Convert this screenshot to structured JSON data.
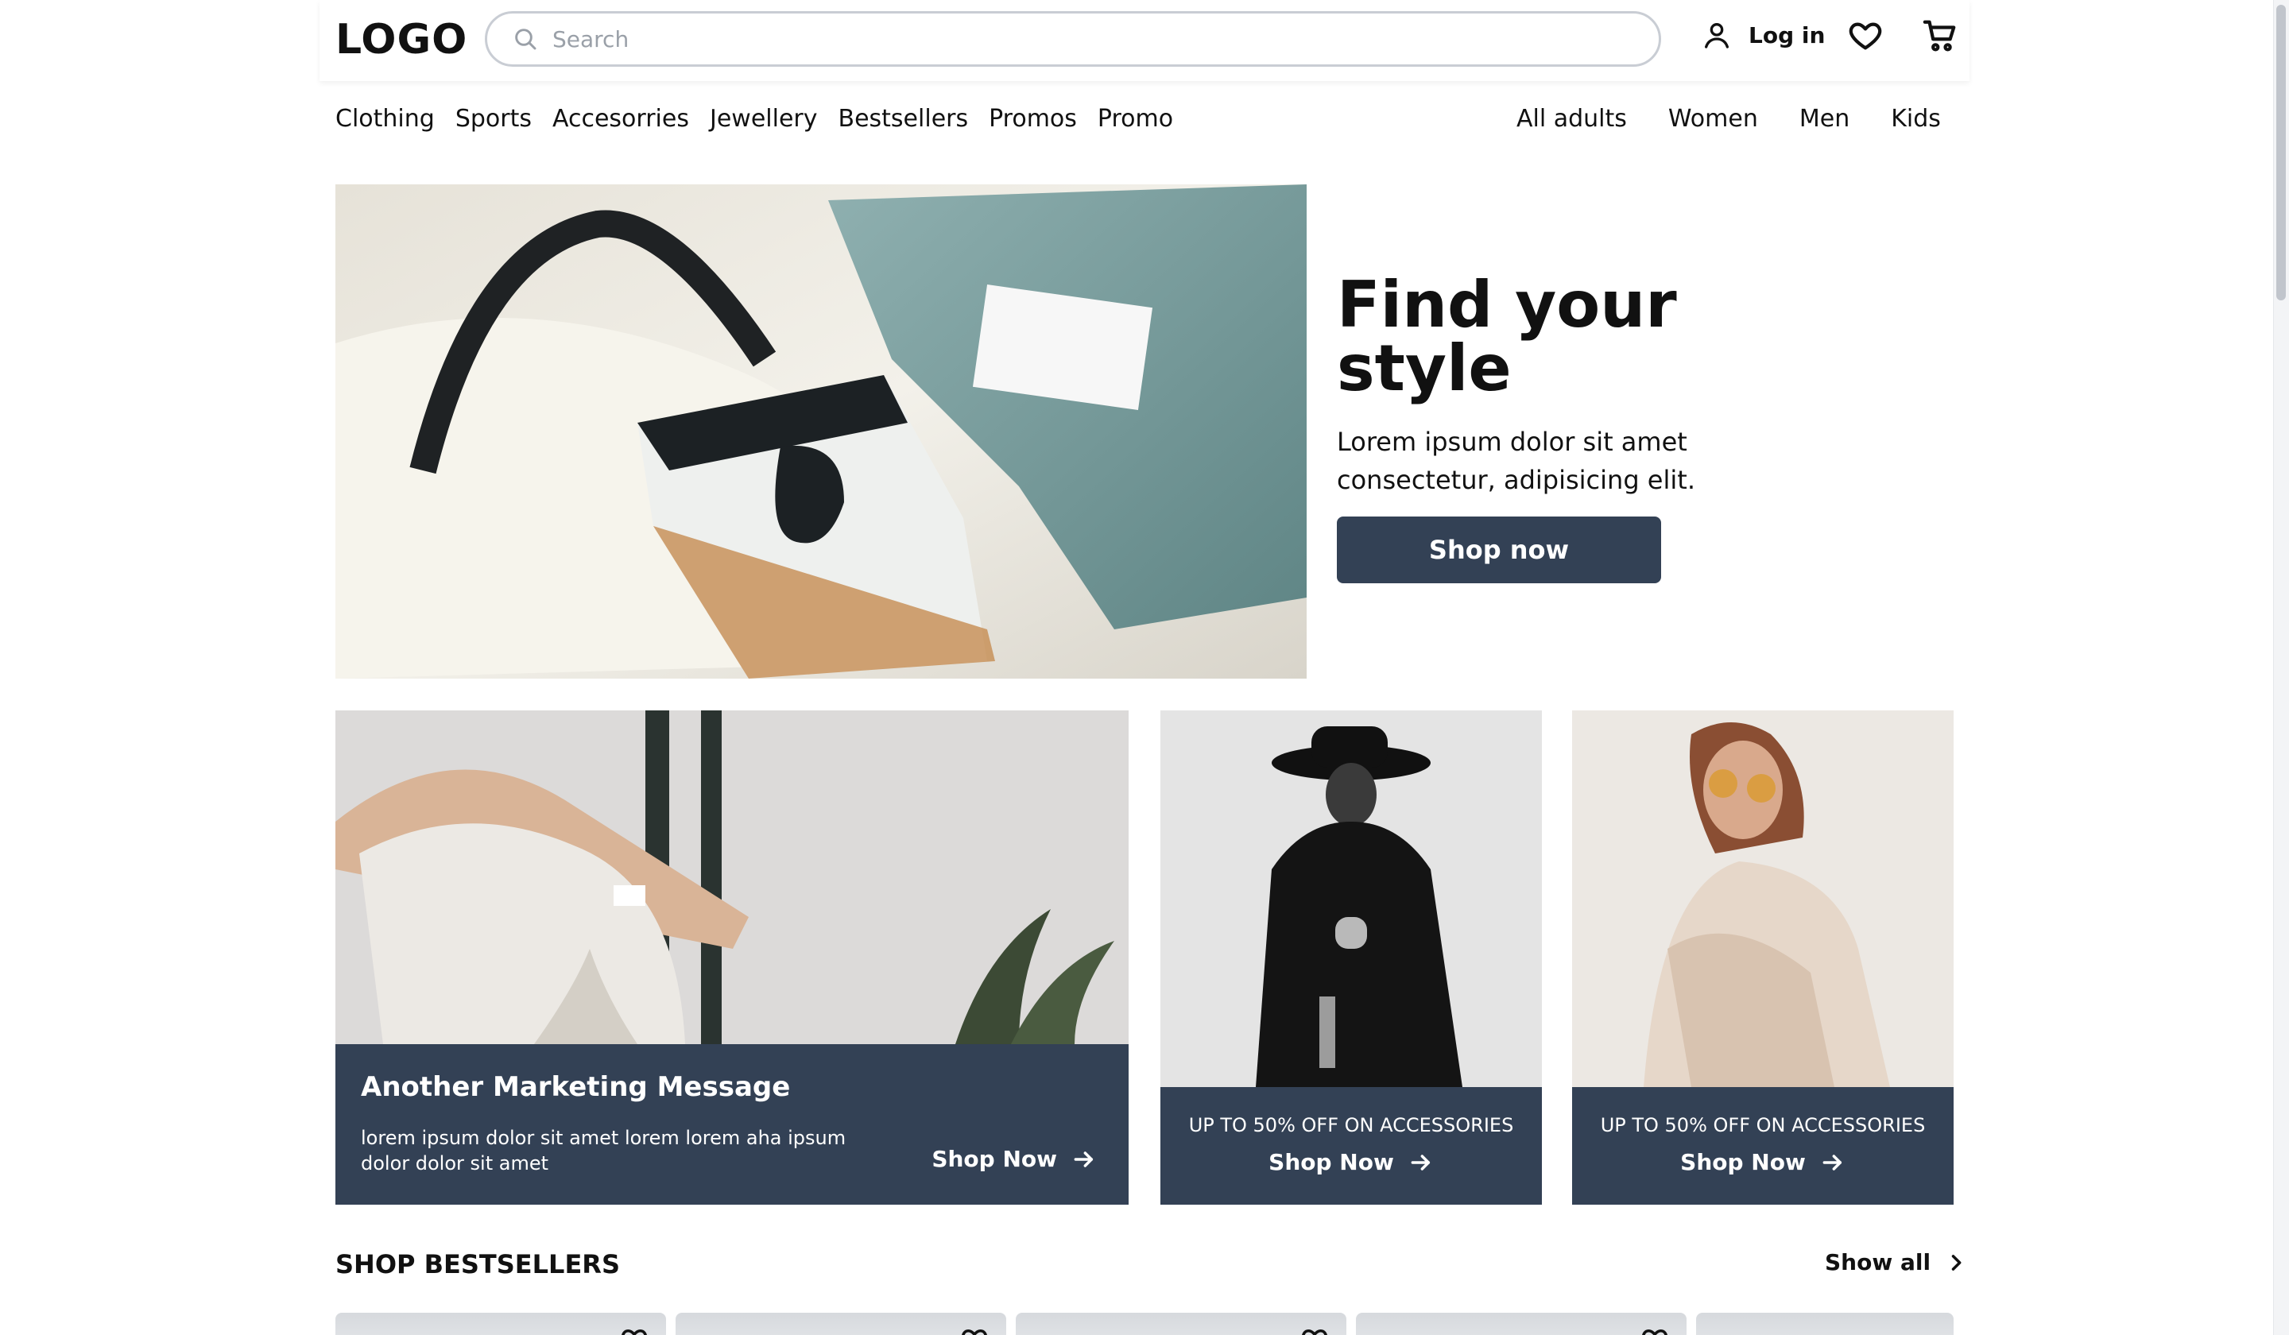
{
  "header": {
    "logo": "LOGO",
    "search_placeholder": "Search",
    "search_value": "",
    "login_label": "Log in",
    "icons": [
      "search-icon",
      "user-icon",
      "heart-icon",
      "cart-icon"
    ]
  },
  "nav": {
    "left": [
      "Clothing",
      "Sports",
      "Accesorries",
      "Jewellery",
      "Bestsellers",
      "Promos",
      "Promo"
    ],
    "right": [
      "All adults",
      "Women",
      "Men",
      "Kids"
    ]
  },
  "hero": {
    "title": "Find your style",
    "subtitle": "Lorem ipsum dolor sit amet consectetur, adipisicing elit.",
    "button": "Shop now"
  },
  "tiles": {
    "large": {
      "heading": "Another Marketing Message",
      "body": "lorem ipsum dolor sit amet lorem lorem aha ipsum dolor dolor sit amet",
      "cta": "Shop Now"
    },
    "small": [
      {
        "promo": "UP TO 50% OFF ON ACCESSORIES",
        "cta": "Shop Now"
      },
      {
        "promo": "UP TO 50% OFF ON ACCESSORIES",
        "cta": "Shop Now"
      }
    ]
  },
  "bestsellers": {
    "title": "SHOP BESTSELLERS",
    "show_all": "Show all",
    "product_count_visible": 5
  },
  "colors": {
    "accent": "#334155",
    "text": "#111111",
    "border": "#c9cdd4"
  }
}
